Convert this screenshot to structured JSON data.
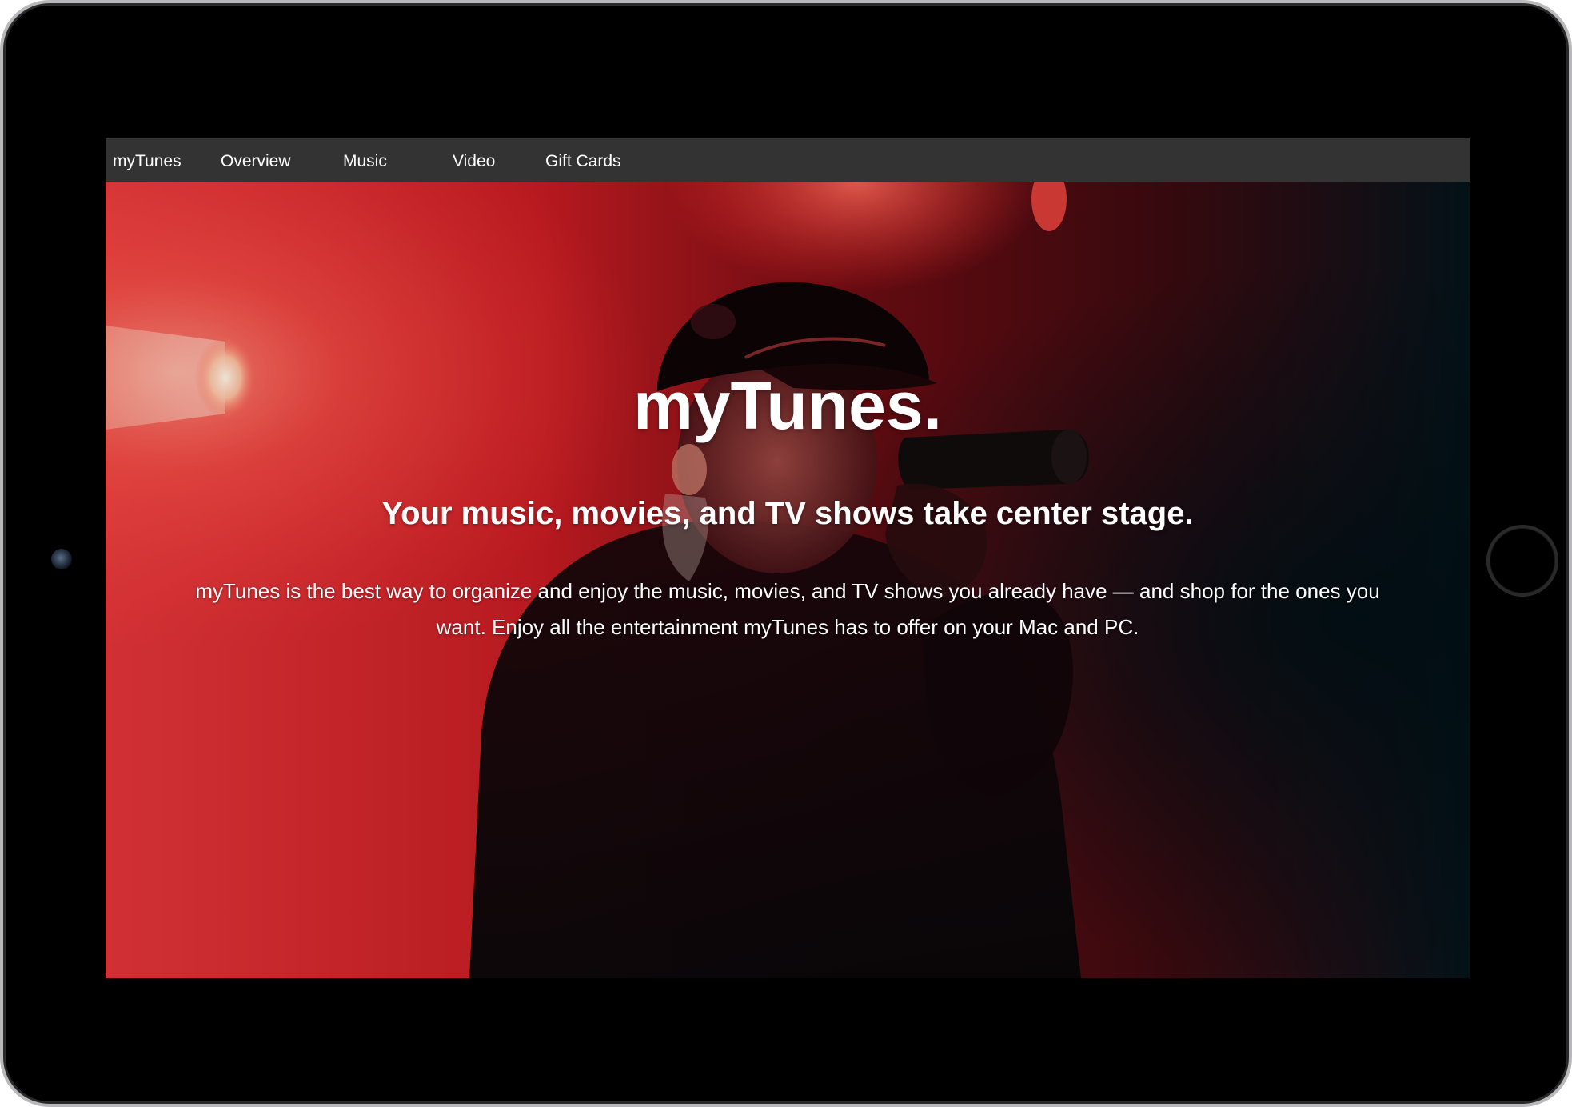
{
  "nav": {
    "brand": "myTunes",
    "items": [
      {
        "label": "Overview"
      },
      {
        "label": "Music"
      },
      {
        "label": "Video"
      },
      {
        "label": "Gift Cards"
      }
    ]
  },
  "hero": {
    "title": "myTunes.",
    "subtitle": "Your music, movies, and TV shows take center stage.",
    "body": "myTunes is the best way to organize and enjoy the music, movies, and TV shows you already have — and shop for the ones you want. Enjoy all the entertainment myTunes has to offer on your Mac and PC.",
    "background_description_icon": "concert-performer-photo"
  },
  "colors": {
    "navbar_bg": "#333333",
    "text": "#ffffff",
    "hero_red": "#d8242a",
    "hero_dark": "#031014",
    "device_frame": "#000000"
  }
}
